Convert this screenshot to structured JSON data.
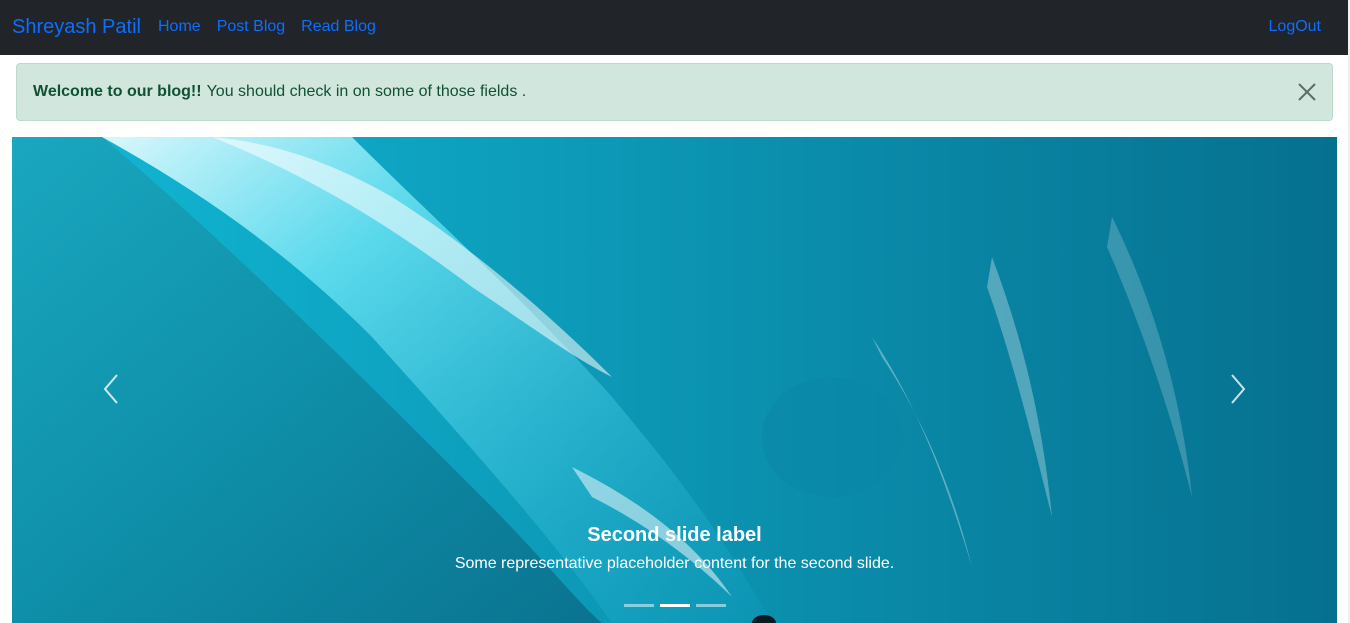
{
  "navbar": {
    "brand": "Shreyash Patil",
    "links": [
      {
        "label": "Home"
      },
      {
        "label": "Post Blog"
      },
      {
        "label": "Read Blog"
      }
    ],
    "logout_label": "LogOut"
  },
  "alert": {
    "strong_text": "Welcome to our blog!!",
    "message": "You should check in on some of those fields ."
  },
  "carousel": {
    "caption_title": "Second slide label",
    "caption_text": "Some representative placeholder content for the second slide.",
    "slide_count": 3,
    "active_slide": 2
  },
  "colors": {
    "navbar_bg": "#212529",
    "link": "#0d6efd",
    "alert_bg": "#d1e7dd",
    "alert_text": "#0f5132"
  }
}
